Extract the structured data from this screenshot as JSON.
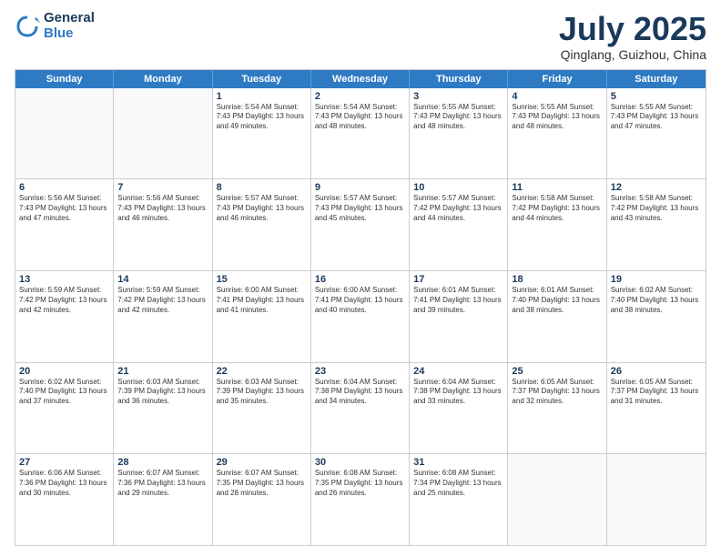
{
  "logo": {
    "general": "General",
    "blue": "Blue"
  },
  "title": "July 2025",
  "location": "Qinglang, Guizhou, China",
  "days_of_week": [
    "Sunday",
    "Monday",
    "Tuesday",
    "Wednesday",
    "Thursday",
    "Friday",
    "Saturday"
  ],
  "weeks": [
    [
      {
        "day": "",
        "info": ""
      },
      {
        "day": "",
        "info": ""
      },
      {
        "day": "1",
        "info": "Sunrise: 5:54 AM\nSunset: 7:43 PM\nDaylight: 13 hours and 49 minutes."
      },
      {
        "day": "2",
        "info": "Sunrise: 5:54 AM\nSunset: 7:43 PM\nDaylight: 13 hours and 48 minutes."
      },
      {
        "day": "3",
        "info": "Sunrise: 5:55 AM\nSunset: 7:43 PM\nDaylight: 13 hours and 48 minutes."
      },
      {
        "day": "4",
        "info": "Sunrise: 5:55 AM\nSunset: 7:43 PM\nDaylight: 13 hours and 48 minutes."
      },
      {
        "day": "5",
        "info": "Sunrise: 5:55 AM\nSunset: 7:43 PM\nDaylight: 13 hours and 47 minutes."
      }
    ],
    [
      {
        "day": "6",
        "info": "Sunrise: 5:56 AM\nSunset: 7:43 PM\nDaylight: 13 hours and 47 minutes."
      },
      {
        "day": "7",
        "info": "Sunrise: 5:56 AM\nSunset: 7:43 PM\nDaylight: 13 hours and 46 minutes."
      },
      {
        "day": "8",
        "info": "Sunrise: 5:57 AM\nSunset: 7:43 PM\nDaylight: 13 hours and 46 minutes."
      },
      {
        "day": "9",
        "info": "Sunrise: 5:57 AM\nSunset: 7:43 PM\nDaylight: 13 hours and 45 minutes."
      },
      {
        "day": "10",
        "info": "Sunrise: 5:57 AM\nSunset: 7:42 PM\nDaylight: 13 hours and 44 minutes."
      },
      {
        "day": "11",
        "info": "Sunrise: 5:58 AM\nSunset: 7:42 PM\nDaylight: 13 hours and 44 minutes."
      },
      {
        "day": "12",
        "info": "Sunrise: 5:58 AM\nSunset: 7:42 PM\nDaylight: 13 hours and 43 minutes."
      }
    ],
    [
      {
        "day": "13",
        "info": "Sunrise: 5:59 AM\nSunset: 7:42 PM\nDaylight: 13 hours and 42 minutes."
      },
      {
        "day": "14",
        "info": "Sunrise: 5:59 AM\nSunset: 7:42 PM\nDaylight: 13 hours and 42 minutes."
      },
      {
        "day": "15",
        "info": "Sunrise: 6:00 AM\nSunset: 7:41 PM\nDaylight: 13 hours and 41 minutes."
      },
      {
        "day": "16",
        "info": "Sunrise: 6:00 AM\nSunset: 7:41 PM\nDaylight: 13 hours and 40 minutes."
      },
      {
        "day": "17",
        "info": "Sunrise: 6:01 AM\nSunset: 7:41 PM\nDaylight: 13 hours and 39 minutes."
      },
      {
        "day": "18",
        "info": "Sunrise: 6:01 AM\nSunset: 7:40 PM\nDaylight: 13 hours and 38 minutes."
      },
      {
        "day": "19",
        "info": "Sunrise: 6:02 AM\nSunset: 7:40 PM\nDaylight: 13 hours and 38 minutes."
      }
    ],
    [
      {
        "day": "20",
        "info": "Sunrise: 6:02 AM\nSunset: 7:40 PM\nDaylight: 13 hours and 37 minutes."
      },
      {
        "day": "21",
        "info": "Sunrise: 6:03 AM\nSunset: 7:39 PM\nDaylight: 13 hours and 36 minutes."
      },
      {
        "day": "22",
        "info": "Sunrise: 6:03 AM\nSunset: 7:39 PM\nDaylight: 13 hours and 35 minutes."
      },
      {
        "day": "23",
        "info": "Sunrise: 6:04 AM\nSunset: 7:38 PM\nDaylight: 13 hours and 34 minutes."
      },
      {
        "day": "24",
        "info": "Sunrise: 6:04 AM\nSunset: 7:38 PM\nDaylight: 13 hours and 33 minutes."
      },
      {
        "day": "25",
        "info": "Sunrise: 6:05 AM\nSunset: 7:37 PM\nDaylight: 13 hours and 32 minutes."
      },
      {
        "day": "26",
        "info": "Sunrise: 6:05 AM\nSunset: 7:37 PM\nDaylight: 13 hours and 31 minutes."
      }
    ],
    [
      {
        "day": "27",
        "info": "Sunrise: 6:06 AM\nSunset: 7:36 PM\nDaylight: 13 hours and 30 minutes."
      },
      {
        "day": "28",
        "info": "Sunrise: 6:07 AM\nSunset: 7:36 PM\nDaylight: 13 hours and 29 minutes."
      },
      {
        "day": "29",
        "info": "Sunrise: 6:07 AM\nSunset: 7:35 PM\nDaylight: 13 hours and 28 minutes."
      },
      {
        "day": "30",
        "info": "Sunrise: 6:08 AM\nSunset: 7:35 PM\nDaylight: 13 hours and 26 minutes."
      },
      {
        "day": "31",
        "info": "Sunrise: 6:08 AM\nSunset: 7:34 PM\nDaylight: 13 hours and 25 minutes."
      },
      {
        "day": "",
        "info": ""
      },
      {
        "day": "",
        "info": ""
      }
    ]
  ]
}
